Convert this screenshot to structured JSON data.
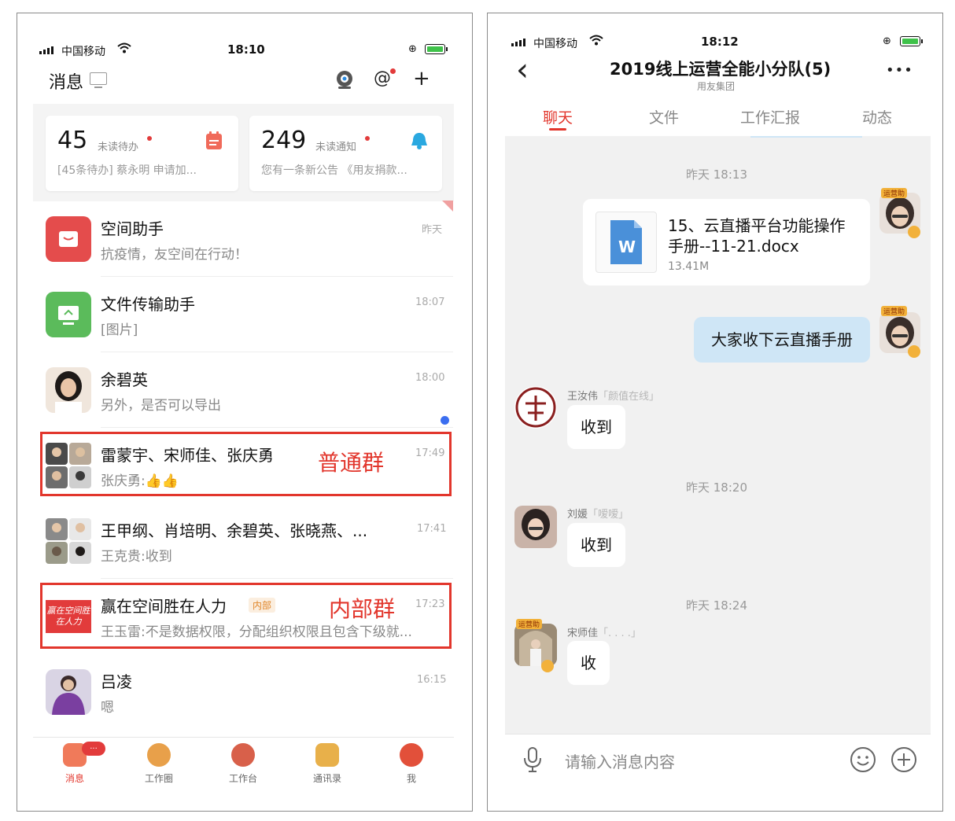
{
  "left": {
    "status": {
      "carrier": "中国移动",
      "time": "18:10"
    },
    "header": {
      "title": "消息"
    },
    "cards": [
      {
        "count": "45",
        "label": "未读待办",
        "preview": "[45条待办] 蔡永明 申请加..."
      },
      {
        "count": "249",
        "label": "未读通知",
        "preview": "您有一条新公告 《用友捐款..."
      }
    ],
    "rows": [
      {
        "name": "空间助手",
        "preview": "抗疫情，友空间在行动！",
        "time": "昨天"
      },
      {
        "name": "文件传输助手",
        "preview": "[图片]",
        "time": "18:07"
      },
      {
        "name": "余碧英",
        "preview": "另外，是否可以导出",
        "time": "18:00"
      },
      {
        "name": "雷蒙宇、宋师佳、张庆勇",
        "preview": "张庆勇:👍👍",
        "time": "17:49"
      },
      {
        "name": "王甲纲、肖培明、余碧英、张晓燕、...",
        "preview": "王克贵:收到",
        "time": "17:41"
      },
      {
        "name": "赢在空间胜在人力",
        "tag": "内部",
        "preview": "王玉雷:不是数据权限，分配组织权限且包含下级就...",
        "time": "17:23"
      },
      {
        "name": "吕凌",
        "preview": "嗯",
        "time": "16:15"
      }
    ],
    "annotations": {
      "normal_group": "普通群",
      "internal_group": "内部群"
    },
    "group_avatar_text": "赢在空间胜在人力",
    "nav": [
      {
        "label": "消息",
        "badge": "..."
      },
      {
        "label": "工作圈"
      },
      {
        "label": "工作台"
      },
      {
        "label": "通讯录"
      },
      {
        "label": "我"
      }
    ]
  },
  "right": {
    "status": {
      "carrier": "中国移动",
      "time": "18:12"
    },
    "header": {
      "back": "‹",
      "title": "2019线上运营全能小分队(5)",
      "subtitle": "用友集团",
      "more": "•••"
    },
    "tabs": [
      "聊天",
      "文件",
      "工作汇报",
      "动态"
    ],
    "active_tab": 0,
    "messages": {
      "time1": "昨天 18:13",
      "file": {
        "name_line1": "15、云直播平台功能操作",
        "name_line2": "手册--11-21.docx",
        "size": "13.41M",
        "icon_letter": "W"
      },
      "mine_text": "大家收下云直播手册",
      "badge_text": "运营助",
      "msg1": {
        "sender": "王汝伟",
        "status": "「颜值在线」",
        "text": "收到"
      },
      "time2": "昨天 18:20",
      "msg2": {
        "sender": "刘媛",
        "status": "「嗳嗳」",
        "text": "收到"
      },
      "time3": "昨天 18:24",
      "msg3": {
        "sender": "宋师佳",
        "status": "「. . . .」",
        "text": "收"
      }
    },
    "input": {
      "placeholder": "请输入消息内容"
    }
  }
}
